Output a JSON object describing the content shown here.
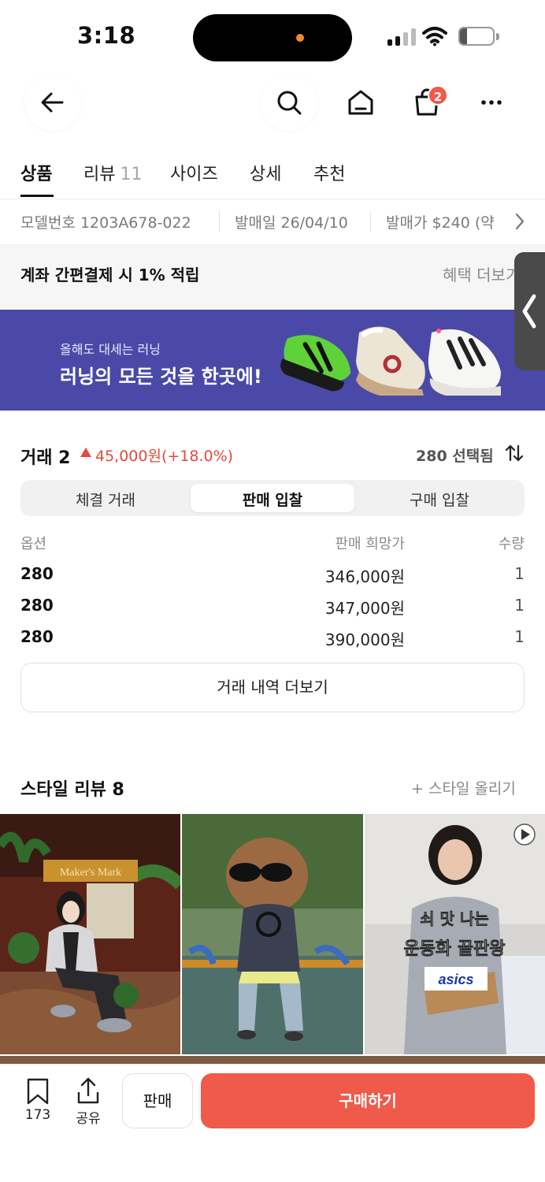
{
  "status_bar": {
    "time": "3:18",
    "battery": "22",
    "battery_level_percent": 22
  },
  "header": {
    "cart_badge": "2"
  },
  "tabs": [
    {
      "label": "상품",
      "active": true
    },
    {
      "label": "리뷰",
      "count": "11"
    },
    {
      "label": "사이즈"
    },
    {
      "label": "상세"
    },
    {
      "label": "추천"
    }
  ],
  "info": {
    "model": "모델번호 1203A678-022",
    "release_date": "발매일 26/04/10",
    "release_price": "발매가 $240 (약"
  },
  "benefit": {
    "text": "계좌 간편결제 시 1% 적립",
    "more": "혜택 더보기"
  },
  "banner": {
    "subtitle": "올해도 대세는 러닝",
    "title": "러닝의 모든 것을 한곳에!"
  },
  "transactions": {
    "title": "거래 2",
    "change": "45,000원(+18.0%)",
    "change_direction": "up",
    "selected": "280 선택됨",
    "segments": [
      "체결 거래",
      "판매 입찰",
      "구매 입찰"
    ],
    "active_segment": 1,
    "headers": {
      "option": "옵션",
      "price": "판매 희망가",
      "qty": "수량"
    },
    "rows": [
      {
        "option": "280",
        "price": "346,000원",
        "qty": "1"
      },
      {
        "option": "280",
        "price": "347,000원",
        "qty": "1"
      },
      {
        "option": "280",
        "price": "390,000원",
        "qty": "1"
      }
    ],
    "more_button": "거래 내역 더보기"
  },
  "style_review": {
    "title": "스타일 리뷰 8",
    "upload": "+ 스타일 올리기",
    "photo1_sign": "Maker's Mark",
    "photo3_caption_line1": "쇠 맛 나는",
    "photo3_caption_line2": "운동화 끝판왕",
    "photo3_brand": "asics"
  },
  "bottom_bar": {
    "bookmark_count": "173",
    "share_label": "공유",
    "sell_label": "판매",
    "buy_label": "구매하기"
  },
  "colors": {
    "accent": "#ef5a4a",
    "banner": "#4a49a7",
    "price_up": "#e4493b"
  }
}
